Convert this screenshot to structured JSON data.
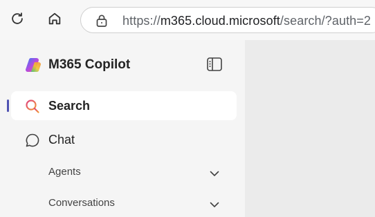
{
  "browser": {
    "url_scheme": "https://",
    "url_host": "m365.cloud.microsoft",
    "url_path": "/search/?auth=2",
    "icons": [
      "refresh-icon",
      "home-icon",
      "lock-icon"
    ]
  },
  "sidebar": {
    "brand_title": "M365 Copilot",
    "items": [
      {
        "label": "Search",
        "icon": "search-icon",
        "active": true
      },
      {
        "label": "Chat",
        "icon": "chat-icon",
        "active": false
      }
    ],
    "sections": [
      {
        "label": "Agents",
        "icon": "chevron-down-icon"
      },
      {
        "label": "Conversations",
        "icon": "chevron-down-icon"
      }
    ]
  },
  "colors": {
    "active_indicator": "#4f52b2",
    "search_icon_gradient": [
      "#e0427e",
      "#f29b38"
    ]
  }
}
